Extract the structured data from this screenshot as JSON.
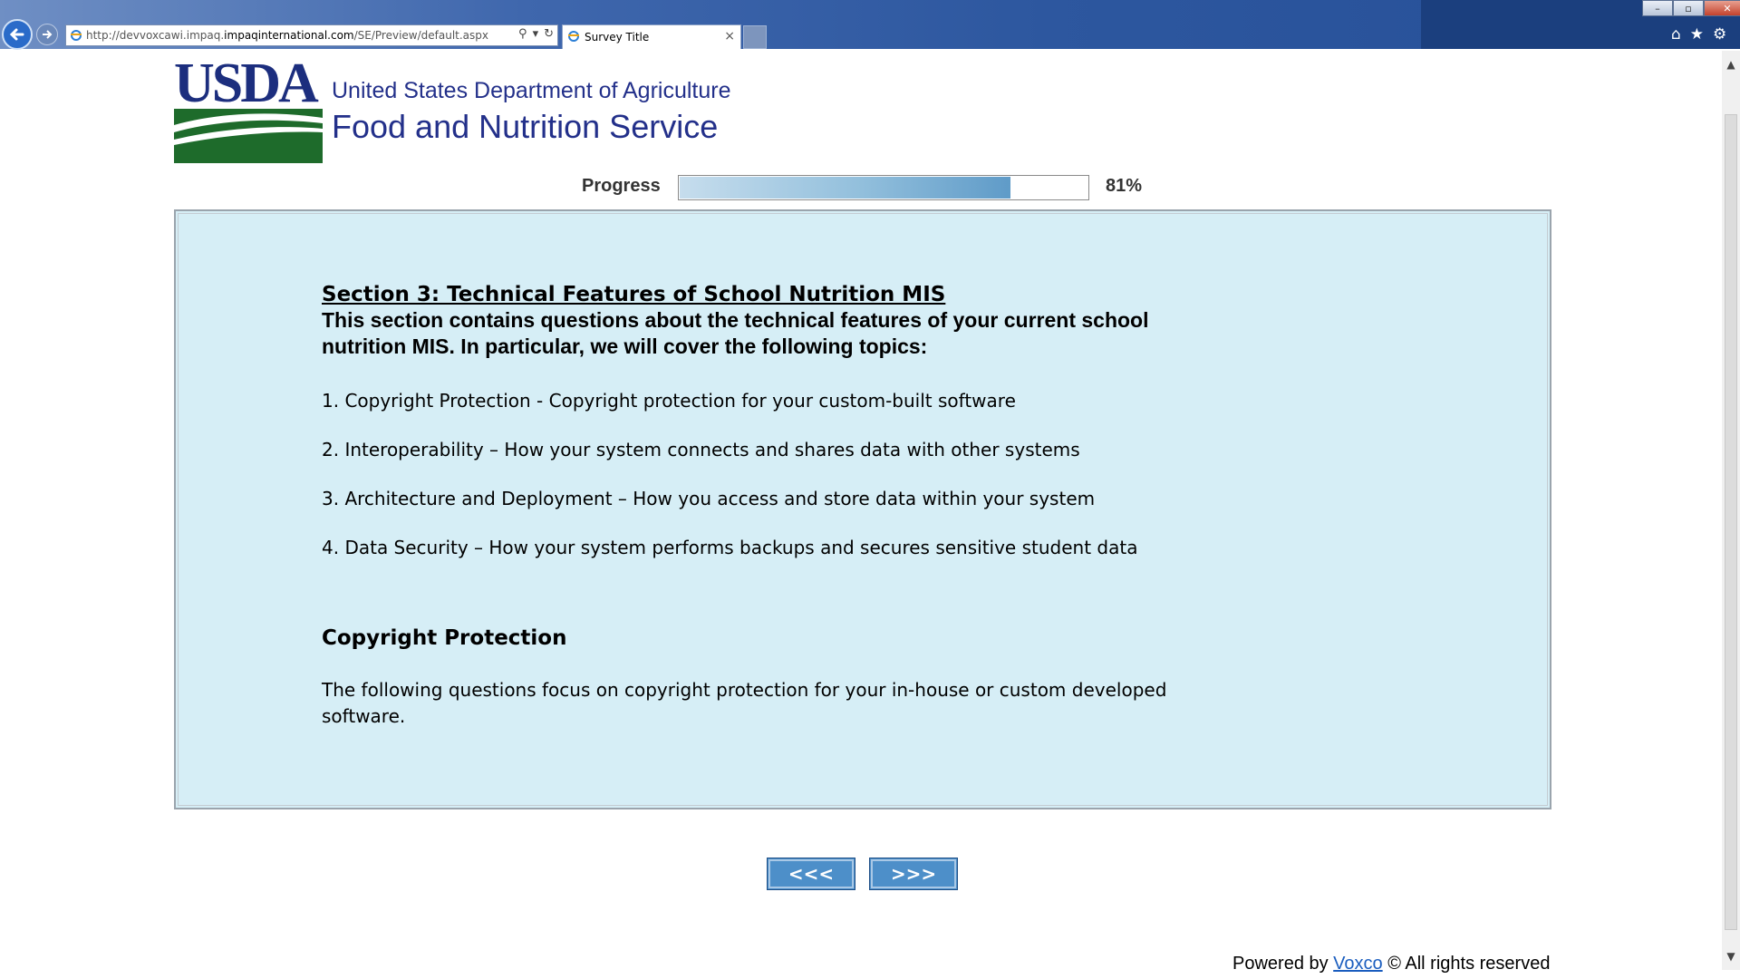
{
  "browser": {
    "address_prefix": "http://devvoxcawi.impaq.",
    "address_domain": "impaqinternational.com",
    "address_path": "/SE/Preview/default.aspx",
    "tab_title": "Survey Title",
    "tab_close": "×",
    "win_min": "–",
    "win_max": "▫",
    "win_close": "✕",
    "home_icon": "⌂",
    "favorites_icon": "★",
    "tools_icon": "⚙",
    "search_glyph": "⚲",
    "dropdown_glyph": "▾",
    "refresh_glyph": "↻",
    "back_glyph": "←",
    "forward_glyph": "→"
  },
  "header": {
    "logo_text": "USDA",
    "agency_line1": "United States Department of Agriculture",
    "agency_line2": "Food and Nutrition Service"
  },
  "progress": {
    "label": "Progress",
    "percent_text": "81%",
    "value": 0.81
  },
  "content": {
    "section_title": "Section 3: Technical Features of School Nutrition MIS",
    "section_intro": "This section contains questions about the technical features of your current school nutrition MIS. In particular, we will cover the following topics:",
    "topics": [
      "1. Copyright Protection - Copyright protection for your custom-built software",
      "2. Interoperability – How your system connects and shares data with other systems",
      "3. Architecture and Deployment – How you access and store data within your system",
      "4. Data Security – How your system performs backups and secures sensitive student data"
    ],
    "sub_heading": "Copyright Protection",
    "sub_text": "The following questions focus on copyright protection for your in-house or custom developed software."
  },
  "navigation": {
    "prev_label": "<<<",
    "next_label": ">>>"
  },
  "footer": {
    "powered_by": "Powered by ",
    "link_text": "Voxco",
    "rights": " © All rights reserved"
  },
  "colors": {
    "panel_bg": "#d6eef6",
    "button_bg": "#4d8fc9",
    "agency_text": "#23308a",
    "logo_green": "#1e6b2b"
  },
  "scrollbar": {
    "up_glyph": "▲",
    "down_glyph": "▼"
  }
}
